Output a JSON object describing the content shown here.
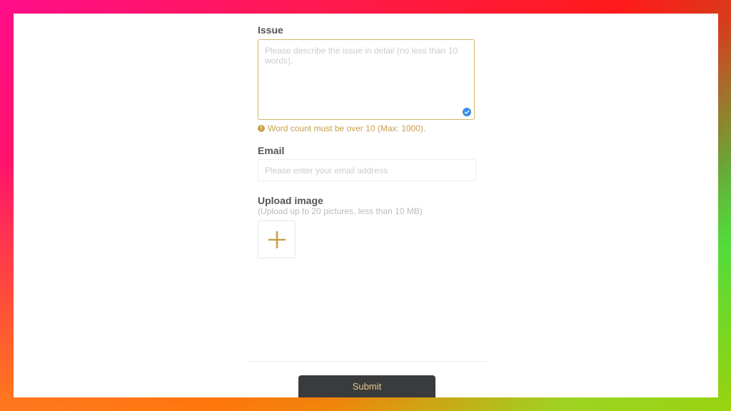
{
  "issue": {
    "label": "Issue",
    "placeholder": "Please describe the issue in detail (no less than 10 words).",
    "value": "",
    "warning": "Word count must be over 10 (Max: 1000)."
  },
  "email": {
    "label": "Email",
    "placeholder": "Please enter your email address",
    "value": ""
  },
  "upload": {
    "label": "Upload image",
    "hint": "(Upload up to 20 pictures, less than 10 MB)"
  },
  "submit": {
    "label": "Submit"
  },
  "colors": {
    "accent": "#d4b56a",
    "warning": "#c9a04a",
    "check": "#3a8ee6",
    "button_bg": "#3a3b3d",
    "button_text": "#e8c989"
  },
  "icons": {
    "check": "check-circle-icon",
    "warning": "exclamation-circle-icon",
    "upload": "plus-icon"
  }
}
